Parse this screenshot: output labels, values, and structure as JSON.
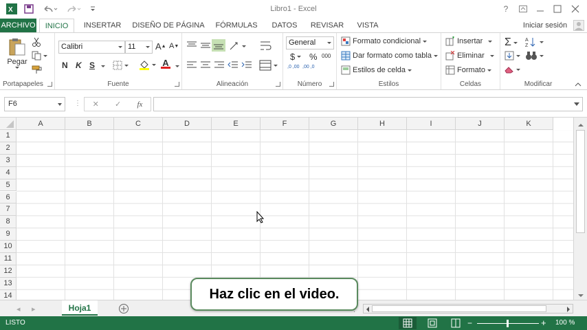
{
  "window": {
    "title": "Libro1 - Excel",
    "help": "?"
  },
  "tabs": [
    {
      "label": "ARCHIVO"
    },
    {
      "label": "INICIO"
    },
    {
      "label": "INSERTAR"
    },
    {
      "label": "DISEÑO DE PÁGINA"
    },
    {
      "label": "FÓRMULAS"
    },
    {
      "label": "DATOS"
    },
    {
      "label": "REVISAR"
    },
    {
      "label": "VISTA"
    }
  ],
  "signin": "Iniciar sesión",
  "ribbon": {
    "clipboard": {
      "paste": "Pegar",
      "label": "Portapapeles"
    },
    "font": {
      "name": "Calibri",
      "size": "11",
      "bold": "N",
      "italic": "K",
      "underline": "S",
      "fontcolor_letter": "A",
      "grow": "A",
      "shrink": "A",
      "label": "Fuente"
    },
    "alignment": {
      "label": "Alineación"
    },
    "number": {
      "format": "General",
      "currency": "$",
      "percent": "%",
      "comma": "000",
      "inc_dec": ",0 ,00",
      "dec_dec": ",00 ,0",
      "label": "Número"
    },
    "styles": {
      "conditional": "Formato condicional",
      "table": "Dar formato como tabla",
      "cell": "Estilos de celda",
      "label": "Estilos"
    },
    "cells": {
      "insert": "Insertar",
      "delete": "Eliminar",
      "format": "Formato",
      "label": "Celdas"
    },
    "edit": {
      "label": "Modificar"
    }
  },
  "formula": {
    "namebox": "F6",
    "fx": "fx"
  },
  "grid": {
    "columns": [
      "A",
      "B",
      "C",
      "D",
      "E",
      "F",
      "G",
      "H",
      "I",
      "J",
      "K"
    ],
    "rows": [
      "1",
      "2",
      "3",
      "4",
      "5",
      "6",
      "7",
      "8",
      "9",
      "10",
      "11",
      "12",
      "13",
      "14"
    ]
  },
  "sheet": {
    "tab": "Hoja1"
  },
  "status": {
    "ready": "LISTO",
    "zoom": "100 %"
  },
  "callout": "Haz clic en el video.",
  "colors": {
    "accent": "#217346"
  }
}
